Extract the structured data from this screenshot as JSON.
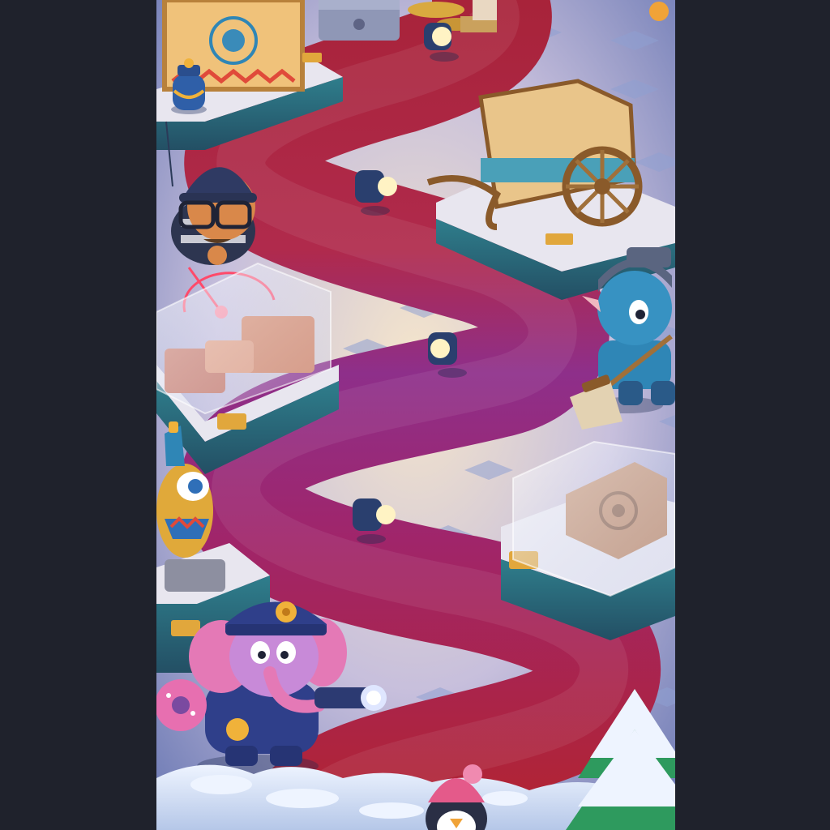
{
  "scene": {
    "colors": {
      "frame": "#1f222c",
      "floor_light": "#f3e3c9",
      "floor_mid": "#b9b3d8",
      "floor_dark": "#6f79b6",
      "tile": "#8f9fd0",
      "carpet_red": "#b3242e",
      "carpet_purple": "#8d2f86",
      "pedestal": "#3a6b78",
      "pedestal_top": "#e9e9f1",
      "plaque": "#e1a73c",
      "snow": "#dbe6f6"
    },
    "icons": [
      "sun-banner-icon",
      "honey-jar-icon",
      "treasure-chest-icon",
      "spotlight-icon",
      "chariot-icon",
      "stone-block-icon",
      "glass-case-icon",
      "owl-statue-icon",
      "stone-tablet-icon",
      "thief-character-icon",
      "laser-beam-icon",
      "janitor-character-icon",
      "broom-icon",
      "police-elephant-icon",
      "flashlight-icon",
      "donut-icon",
      "penguin-icon",
      "snowy-tree-icon",
      "police-badge-icon"
    ]
  }
}
